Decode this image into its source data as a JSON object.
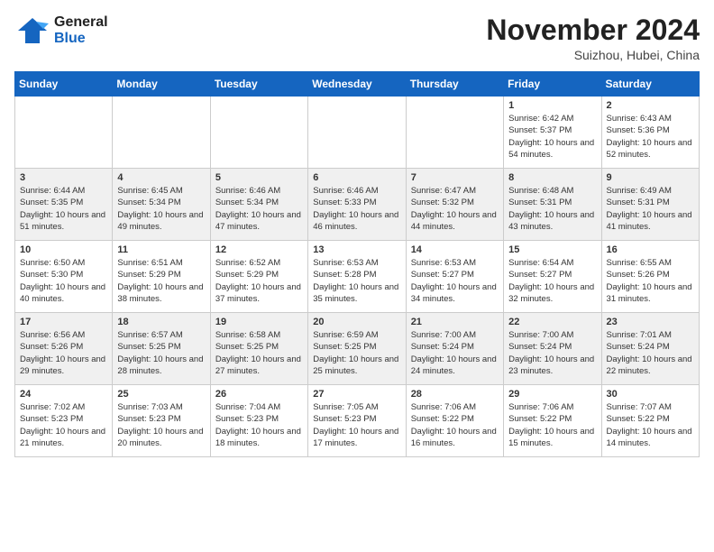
{
  "header": {
    "logo": {
      "line1": "General",
      "line2": "Blue"
    },
    "title": "November 2024",
    "subtitle": "Suizhou, Hubei, China"
  },
  "calendar": {
    "days_of_week": [
      "Sunday",
      "Monday",
      "Tuesday",
      "Wednesday",
      "Thursday",
      "Friday",
      "Saturday"
    ],
    "weeks": [
      [
        {
          "day": "",
          "info": ""
        },
        {
          "day": "",
          "info": ""
        },
        {
          "day": "",
          "info": ""
        },
        {
          "day": "",
          "info": ""
        },
        {
          "day": "",
          "info": ""
        },
        {
          "day": "1",
          "info": "Sunrise: 6:42 AM\nSunset: 5:37 PM\nDaylight: 10 hours and 54 minutes."
        },
        {
          "day": "2",
          "info": "Sunrise: 6:43 AM\nSunset: 5:36 PM\nDaylight: 10 hours and 52 minutes."
        }
      ],
      [
        {
          "day": "3",
          "info": "Sunrise: 6:44 AM\nSunset: 5:35 PM\nDaylight: 10 hours and 51 minutes."
        },
        {
          "day": "4",
          "info": "Sunrise: 6:45 AM\nSunset: 5:34 PM\nDaylight: 10 hours and 49 minutes."
        },
        {
          "day": "5",
          "info": "Sunrise: 6:46 AM\nSunset: 5:34 PM\nDaylight: 10 hours and 47 minutes."
        },
        {
          "day": "6",
          "info": "Sunrise: 6:46 AM\nSunset: 5:33 PM\nDaylight: 10 hours and 46 minutes."
        },
        {
          "day": "7",
          "info": "Sunrise: 6:47 AM\nSunset: 5:32 PM\nDaylight: 10 hours and 44 minutes."
        },
        {
          "day": "8",
          "info": "Sunrise: 6:48 AM\nSunset: 5:31 PM\nDaylight: 10 hours and 43 minutes."
        },
        {
          "day": "9",
          "info": "Sunrise: 6:49 AM\nSunset: 5:31 PM\nDaylight: 10 hours and 41 minutes."
        }
      ],
      [
        {
          "day": "10",
          "info": "Sunrise: 6:50 AM\nSunset: 5:30 PM\nDaylight: 10 hours and 40 minutes."
        },
        {
          "day": "11",
          "info": "Sunrise: 6:51 AM\nSunset: 5:29 PM\nDaylight: 10 hours and 38 minutes."
        },
        {
          "day": "12",
          "info": "Sunrise: 6:52 AM\nSunset: 5:29 PM\nDaylight: 10 hours and 37 minutes."
        },
        {
          "day": "13",
          "info": "Sunrise: 6:53 AM\nSunset: 5:28 PM\nDaylight: 10 hours and 35 minutes."
        },
        {
          "day": "14",
          "info": "Sunrise: 6:53 AM\nSunset: 5:27 PM\nDaylight: 10 hours and 34 minutes."
        },
        {
          "day": "15",
          "info": "Sunrise: 6:54 AM\nSunset: 5:27 PM\nDaylight: 10 hours and 32 minutes."
        },
        {
          "day": "16",
          "info": "Sunrise: 6:55 AM\nSunset: 5:26 PM\nDaylight: 10 hours and 31 minutes."
        }
      ],
      [
        {
          "day": "17",
          "info": "Sunrise: 6:56 AM\nSunset: 5:26 PM\nDaylight: 10 hours and 29 minutes."
        },
        {
          "day": "18",
          "info": "Sunrise: 6:57 AM\nSunset: 5:25 PM\nDaylight: 10 hours and 28 minutes."
        },
        {
          "day": "19",
          "info": "Sunrise: 6:58 AM\nSunset: 5:25 PM\nDaylight: 10 hours and 27 minutes."
        },
        {
          "day": "20",
          "info": "Sunrise: 6:59 AM\nSunset: 5:25 PM\nDaylight: 10 hours and 25 minutes."
        },
        {
          "day": "21",
          "info": "Sunrise: 7:00 AM\nSunset: 5:24 PM\nDaylight: 10 hours and 24 minutes."
        },
        {
          "day": "22",
          "info": "Sunrise: 7:00 AM\nSunset: 5:24 PM\nDaylight: 10 hours and 23 minutes."
        },
        {
          "day": "23",
          "info": "Sunrise: 7:01 AM\nSunset: 5:24 PM\nDaylight: 10 hours and 22 minutes."
        }
      ],
      [
        {
          "day": "24",
          "info": "Sunrise: 7:02 AM\nSunset: 5:23 PM\nDaylight: 10 hours and 21 minutes."
        },
        {
          "day": "25",
          "info": "Sunrise: 7:03 AM\nSunset: 5:23 PM\nDaylight: 10 hours and 20 minutes."
        },
        {
          "day": "26",
          "info": "Sunrise: 7:04 AM\nSunset: 5:23 PM\nDaylight: 10 hours and 18 minutes."
        },
        {
          "day": "27",
          "info": "Sunrise: 7:05 AM\nSunset: 5:23 PM\nDaylight: 10 hours and 17 minutes."
        },
        {
          "day": "28",
          "info": "Sunrise: 7:06 AM\nSunset: 5:22 PM\nDaylight: 10 hours and 16 minutes."
        },
        {
          "day": "29",
          "info": "Sunrise: 7:06 AM\nSunset: 5:22 PM\nDaylight: 10 hours and 15 minutes."
        },
        {
          "day": "30",
          "info": "Sunrise: 7:07 AM\nSunset: 5:22 PM\nDaylight: 10 hours and 14 minutes."
        }
      ]
    ]
  }
}
